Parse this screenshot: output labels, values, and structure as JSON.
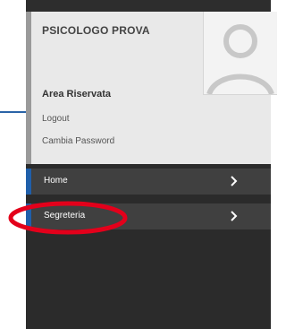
{
  "profile": {
    "name": "PSICOLOGO PROVA",
    "area_label": "Area Riservata",
    "logout_label": "Logout",
    "change_password_label": "Cambia Password"
  },
  "nav": {
    "items": [
      {
        "label": "Home",
        "icon": "chevron-right-icon"
      },
      {
        "label": "Segreteria",
        "icon": "chevron-right-icon"
      }
    ]
  },
  "colors": {
    "sidebar_bg": "#2b2b2b",
    "profile_bg": "#e9e9e9",
    "nav_item_bg": "#404040",
    "accent_blue": "#1f5faa",
    "highlight_red": "#e3001b"
  }
}
